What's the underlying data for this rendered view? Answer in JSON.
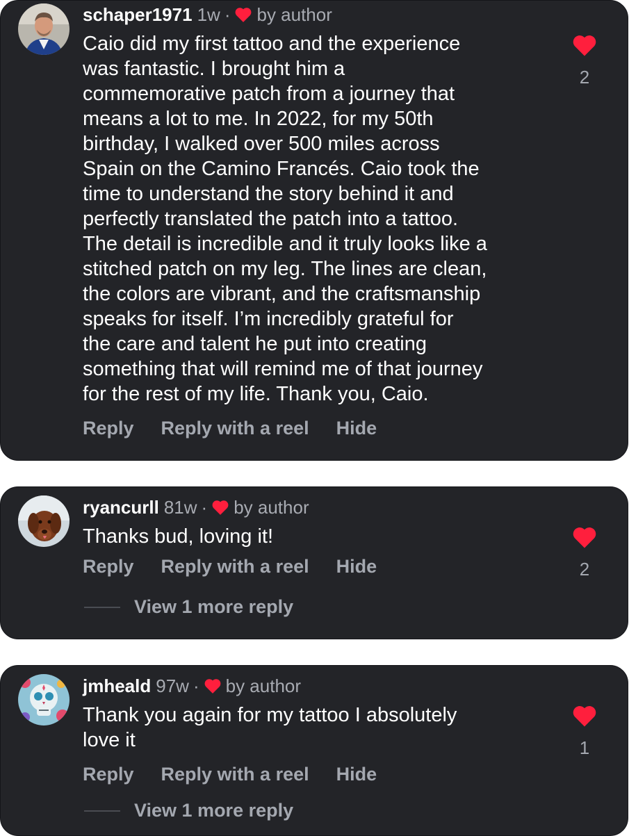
{
  "colors": {
    "card_bg": "#232428",
    "heart": "#ff1f3d",
    "muted": "#a8abb2",
    "text": "#ffffff"
  },
  "comments": [
    {
      "username": "schaper1971",
      "time": "1w",
      "dot": "·",
      "author_tag": "by author",
      "avatar_icon": "man-portrait-avatar",
      "text": "Caio did my first tattoo and the experience\nwas fantastic. I brought him a\ncommemorative patch from a journey that\nmeans a lot to me. In 2022, for my 50th\nbirthday, I walked over 500 miles across\nSpain on the Camino Francés. Caio took the\ntime to understand the story behind it and\nperfectly translated the patch into a tattoo.\nThe detail is incredible and it truly looks like a\nstitched patch on my leg. The lines are clean,\nthe colors are vibrant, and the craftsmanship\nspeaks for itself. I’m incredibly grateful for\nthe care and talent he put into creating\nsomething that will remind me of that journey\nfor the rest of my life. Thank you, Caio.",
      "actions": [
        "Reply",
        "Reply with a reel",
        "Hide"
      ],
      "like_count": "2"
    },
    {
      "username": "ryancurll",
      "time": "81w",
      "dot": "·",
      "author_tag": "by author",
      "avatar_icon": "dog-avatar",
      "text": "Thanks bud, loving it!",
      "actions": [
        "Reply",
        "Reply with a reel",
        "Hide"
      ],
      "like_count": "2",
      "view_more": "View 1 more reply"
    },
    {
      "username": "jmheald",
      "time": "97w",
      "dot": "·",
      "author_tag": "by author",
      "avatar_icon": "sugar-skull-avatar",
      "text": "Thank you again for my tattoo I absolutely\nlove it",
      "actions": [
        "Reply",
        "Reply with a reel",
        "Hide"
      ],
      "like_count": "1",
      "view_more": "View 1 more reply"
    }
  ]
}
